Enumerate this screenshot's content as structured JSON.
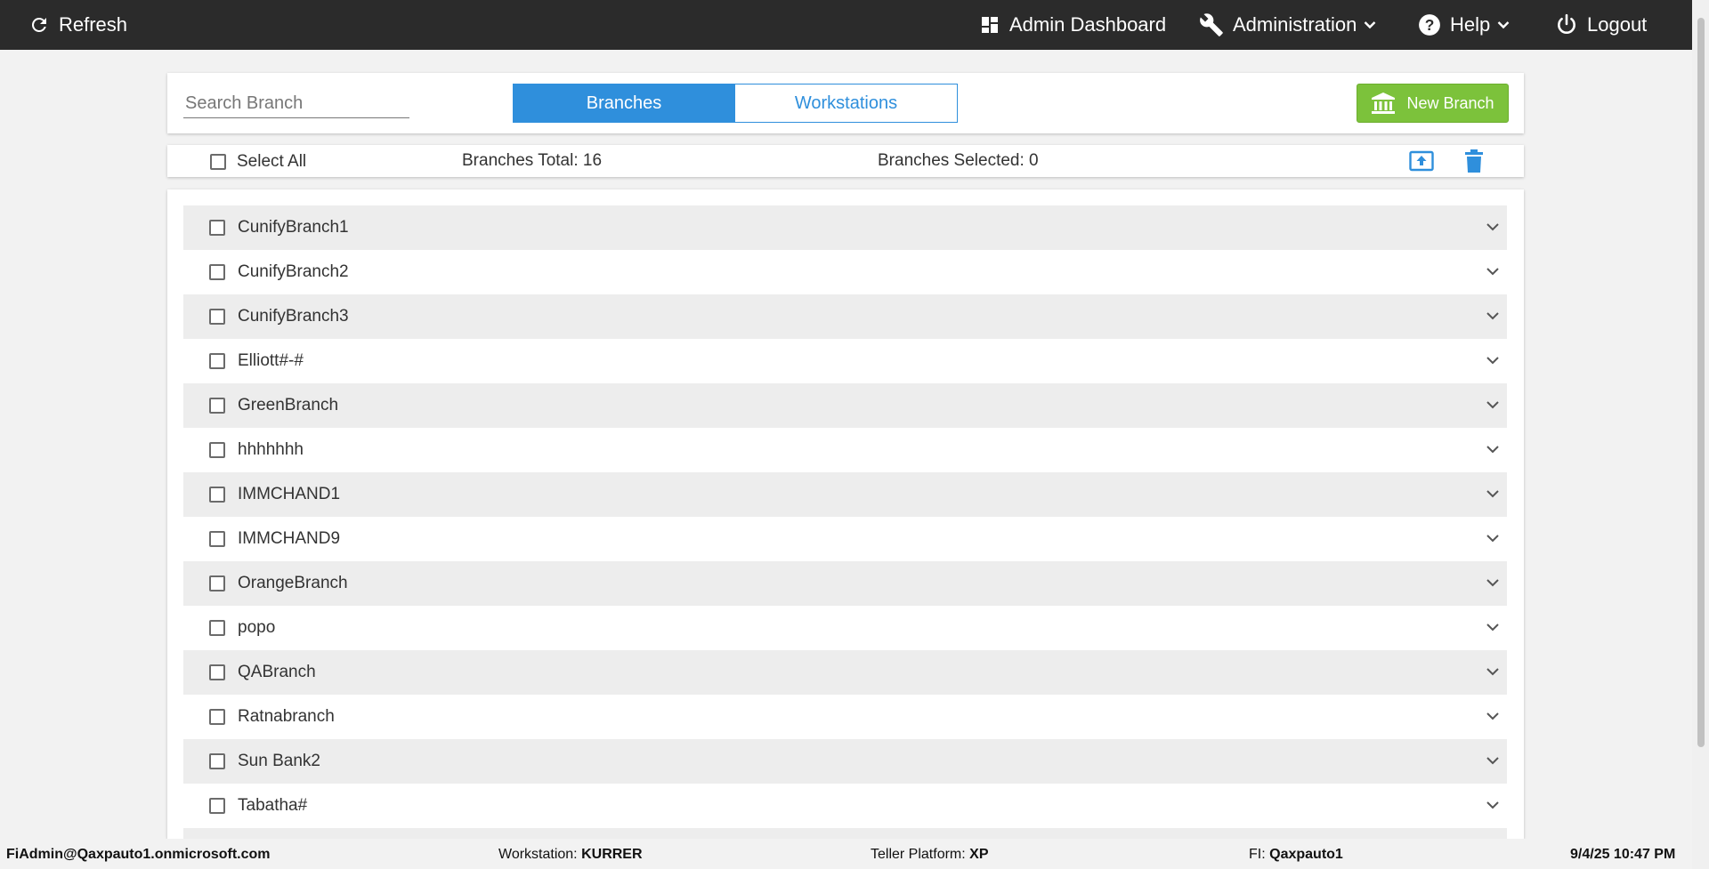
{
  "nav": {
    "refresh_label": "Refresh",
    "dashboard_label": "Admin Dashboard",
    "administration_label": "Administration",
    "help_label": "Help",
    "logout_label": "Logout"
  },
  "search": {
    "placeholder": "Search Branch",
    "value": ""
  },
  "tabs": [
    {
      "label": "Branches",
      "active": true
    },
    {
      "label": "Workstations",
      "active": false
    }
  ],
  "new_branch_label": "New Branch",
  "toolbar": {
    "select_all_label": "Select All",
    "total_text": "Branches Total: 16",
    "selected_text": "Branches Selected: 0"
  },
  "branches": [
    "CunifyBranch1",
    "CunifyBranch2",
    "CunifyBranch3",
    "Elliott#-#",
    "GreenBranch",
    "hhhhhhh",
    "IMMCHAND1",
    "IMMCHAND9",
    "OrangeBranch",
    "popo",
    "QABranch",
    "Ratnabranch",
    "Sun Bank2",
    "Tabatha#"
  ],
  "footer": {
    "user": "FiAdmin@Qaxpauto1.onmicrosoft.com",
    "workstation_label": "Workstation:",
    "workstation_value": "KURRER",
    "platform_label": "Teller Platform:",
    "platform_value": "XP",
    "fi_label": "FI:",
    "fi_value": "Qaxpauto1",
    "datetime": "9/4/25 10:47 PM"
  },
  "colors": {
    "topbar": "#2b2b2b",
    "accent_blue": "#2f8fdc",
    "new_button_green": "#7cc23b",
    "row_stripe": "#ededed"
  },
  "icons": {
    "refresh": "refresh-icon",
    "dashboard": "dashboard-icon",
    "administration": "wrench-icon",
    "help": "help-circle-icon",
    "logout": "power-icon",
    "new_branch": "bank-icon",
    "export": "upload-icon",
    "delete": "trash-icon",
    "row_expand": "chevron-down-icon"
  }
}
